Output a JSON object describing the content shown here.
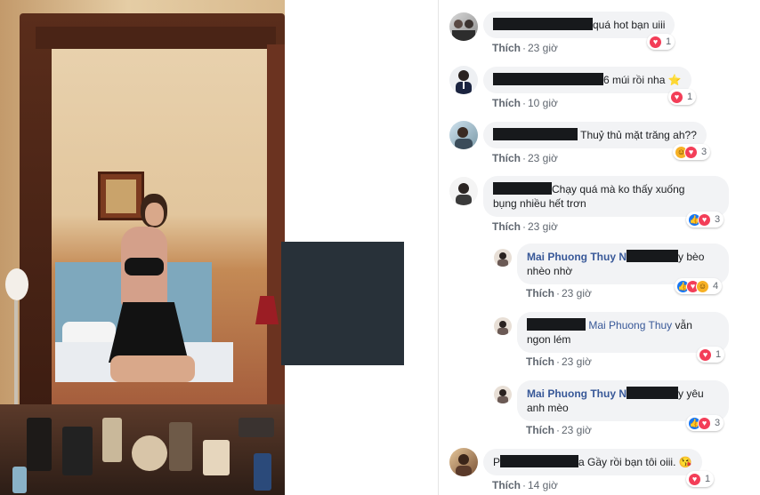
{
  "colors": {
    "link": "#385898",
    "bubble": "#f2f3f5",
    "meta": "#606770",
    "heart": "#f33e58",
    "like": "#1877f2",
    "haha": "#f7b125",
    "redaction": "#17191c"
  },
  "actions": {
    "like": "Thích"
  },
  "comments": [
    {
      "text": "quá hot bạn uiii",
      "time": "23 giờ",
      "reactions": [
        "heart"
      ],
      "count": "1"
    },
    {
      "text": "6 múi rồi nha",
      "emoji": "⭐",
      "time": "10 giờ",
      "reactions": [
        "heart"
      ],
      "count": "1"
    },
    {
      "text": "Thuỷ thủ mặt trăng ah??",
      "time": "23 giờ",
      "reactions": [
        "haha",
        "heart"
      ],
      "count": "3"
    },
    {
      "text": "Chạy quá mà ko thấy xuống",
      "text2": "bụng nhiều hết trơn",
      "time": "23 giờ",
      "reactions": [
        "like",
        "heart"
      ],
      "count": "3"
    },
    {
      "name": "Mai Phuong Thuy",
      "name_fragment": "N",
      "text": "y bèo",
      "text2": "nhèo nhờ",
      "time": "23 giờ",
      "reactions": [
        "like",
        "heart",
        "haha"
      ],
      "count": "4"
    },
    {
      "name": "Mai Phuong Thuy",
      "text": "vẫn",
      "text2": "ngon lém",
      "time": "23 giờ",
      "reactions": [
        "heart"
      ],
      "count": "1"
    },
    {
      "name": "Mai Phuong Thuy",
      "name_fragment": "N",
      "text": "y yêu",
      "text2": "anh mèo",
      "time": "23 giờ",
      "reactions": [
        "like",
        "heart"
      ],
      "count": "3"
    },
    {
      "name_prefix": "P",
      "name_suffix": "a",
      "text": "Gầy rồi bạn tôi oiii.",
      "emoji": "😘",
      "time": "14 giờ",
      "reactions": [
        "heart"
      ],
      "count": "1"
    }
  ]
}
